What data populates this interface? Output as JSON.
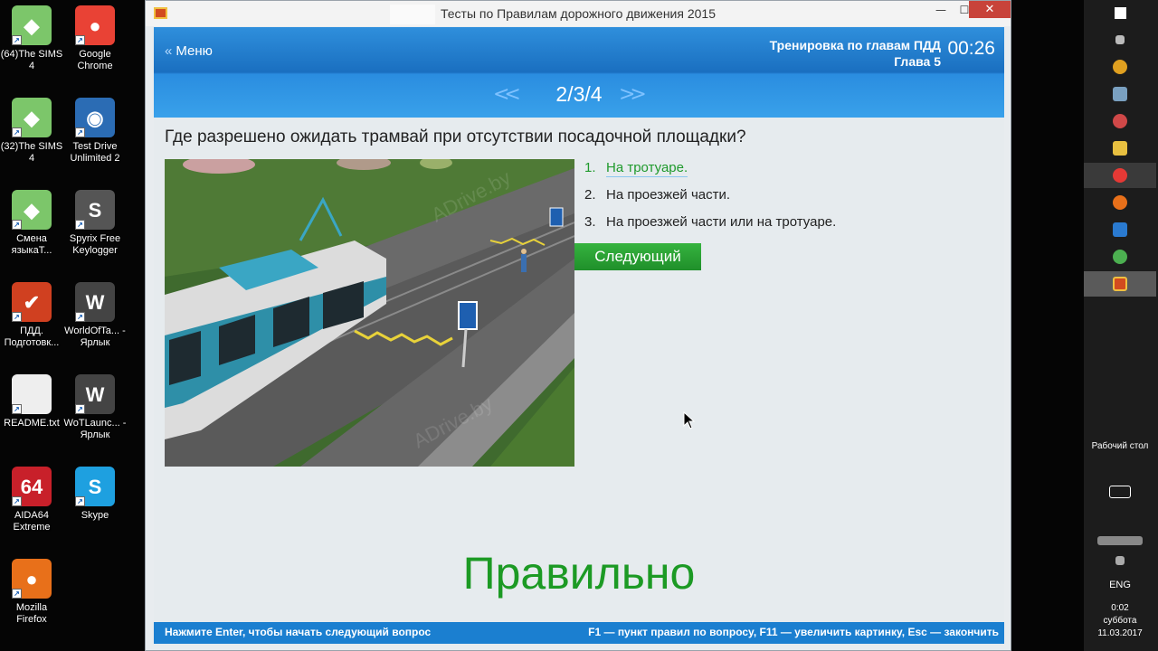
{
  "desktop": {
    "icons": [
      {
        "label": "(64)The SIMS 4",
        "color": "#7cc66a",
        "glyph": "◆"
      },
      {
        "label": "Google Chrome",
        "color": "#e94235",
        "glyph": "●"
      },
      {
        "label": "(32)The SIMS 4",
        "color": "#7cc66a",
        "glyph": "◆"
      },
      {
        "label": "Test Drive Unlimited 2",
        "color": "#2b6cb4",
        "glyph": "◉"
      },
      {
        "label": "Смена языкаТ...",
        "color": "#7cc66a",
        "glyph": "◆"
      },
      {
        "label": "Spyrix Free Keylogger",
        "color": "#555",
        "glyph": "S"
      },
      {
        "label": "ПДД. Подготовк...",
        "color": "#d04020",
        "glyph": "✔"
      },
      {
        "label": "WorldOfTa... - Ярлык",
        "color": "#444",
        "glyph": "W"
      },
      {
        "label": "README.txt",
        "color": "#eee",
        "glyph": ""
      },
      {
        "label": "WoTLaunc... - Ярлык",
        "color": "#444",
        "glyph": "W"
      },
      {
        "label": "AIDA64 Extreme",
        "color": "#c8202a",
        "glyph": "64"
      },
      {
        "label": "Skype",
        "color": "#1ea0e0",
        "glyph": "S"
      },
      {
        "label": "Mozilla Firefox",
        "color": "#e8701a",
        "glyph": "●"
      }
    ]
  },
  "window": {
    "title": "Тесты по Правилам дорожного движения 2015",
    "min": "—",
    "max": "☐",
    "close": "✕"
  },
  "header": {
    "menu_label": "Меню",
    "mode_line1": "Тренировка по главам ПДД",
    "mode_line2": "Глава 5",
    "timer": "00:26",
    "prev": "<<",
    "next": ">>",
    "counter": "2/3/4"
  },
  "question": {
    "text": "Где разрешено ожидать трамвай при отсутствии посадочной площадки?",
    "answers": [
      {
        "num": "1.",
        "text": "На тротуаре."
      },
      {
        "num": "2.",
        "text": "На проезжей части."
      },
      {
        "num": "3.",
        "text": "На проезжей части или на тротуаре."
      }
    ],
    "next_button": "Следующий",
    "result": "Правильно"
  },
  "image": {
    "watermark": "ADrive.by"
  },
  "footer": {
    "left": "Нажмите Enter, чтобы начать следующий вопрос",
    "right": "F1 — пункт правил по вопросу, F11 — увеличить картинку, Esc — закончить"
  },
  "taskbar": {
    "desktop_label": "Рабочий стол",
    "lang": "ENG",
    "time": "0:02",
    "day": "суббота",
    "date": "11.03.2017"
  }
}
